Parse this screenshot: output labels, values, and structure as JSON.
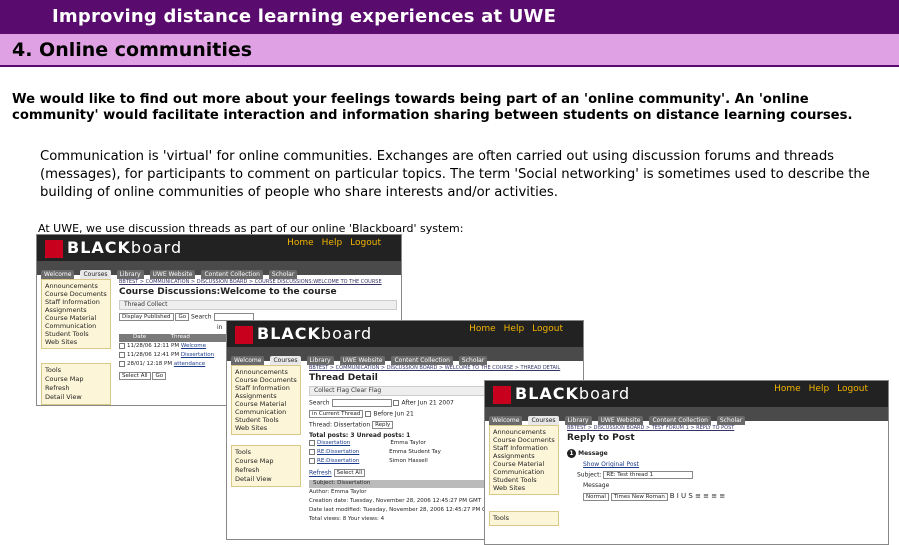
{
  "banner": {
    "title": "Improving distance learning experiences at UWE"
  },
  "section": {
    "title": "4. Online communities"
  },
  "intro": "We would like to find out more about your feelings towards being part of an 'online community'. An 'online community' would facilitate interaction and information sharing between students on distance learning courses.",
  "body": "Communication is 'virtual' for online communities. Exchanges are often carried out using discussion forums and threads (messages), for participants to comment on particular topics. The term 'Social networking' is sometimes used to describe the building of online communities of people who share interests and/or activities.",
  "lead": "At UWE, we use discussion threads as part of our online 'Blackboard' system:",
  "bb": {
    "logo_bold": "BLACK",
    "logo_thin": "board",
    "header_links": [
      "Home",
      "Help",
      "Logout"
    ],
    "tabs": [
      "Welcome",
      "Courses",
      "Library",
      "UWE Website",
      "Content Collection",
      "Scholar"
    ],
    "menu": [
      "Announcements",
      "Course Documents",
      "Staff Information",
      "Assignments",
      "Course Material",
      "Communication",
      "Student Tools",
      "Web Sites"
    ],
    "tools": [
      "Tools",
      "Course Map",
      "Refresh",
      "Detail View"
    ],
    "s1": {
      "crumb": "BBTEST > COMMUNICATION > DISCUSSION BOARD > COURSE DISCUSSIONS:WELCOME TO THE COURSE",
      "title": "Course Discussions:Welcome to the course",
      "bar": "Thread  Collect",
      "display": "Display Published",
      "go": "Go",
      "search": "Search",
      "in": "in",
      "cols": [
        "Date",
        "Thread"
      ],
      "rows": [
        {
          "date": "11/28/06 12:11 PM",
          "thread": "Welcome"
        },
        {
          "date": "11/28/06 12:41 PM",
          "thread": "Dissertation"
        },
        {
          "date": "28/01/ 12:18 PM",
          "thread": "attendance"
        }
      ],
      "select": "Select All"
    },
    "s2": {
      "crumb": "BBTEST > COMMUNICATION > DISCUSSION BOARD > WELCOME TO THE COURSE > THREAD DETAIL",
      "title": "Thread Detail",
      "bar": "Collect  Flag  Clear Flag",
      "search": "Search",
      "in": "in Current Thread",
      "after": "After Jun 21 2007",
      "before": "Before Jun 21",
      "thread_label": "Thread: Dissertation",
      "reply": "Reply",
      "totals": "Total posts: 3    Unread posts: 1",
      "posts": [
        {
          "title": "Dissertation",
          "author": "Emma Taylor"
        },
        {
          "title": "RE:Dissertation",
          "author": "Emma Student Tay"
        },
        {
          "title": "RE:Dissertation",
          "author": "Simon Hassell"
        }
      ],
      "refresh": "Refresh",
      "select": "Select All",
      "subject": "Subject: Dissertation",
      "meta": [
        "Author: Emma Taylor",
        "Creation date: Tuesday, November 28, 2006 12:45:27 PM GMT",
        "Date last modified: Tuesday, November 28, 2006 12:45:27 PM GMT",
        "Total views: 8   Your views: 4"
      ]
    },
    "s3": {
      "crumb": "BBTEST > DISCUSSION BOARD > TEST FORUM 1 > REPLY TO POST",
      "title": "Reply to Post",
      "step": "1",
      "message": "Message",
      "show": "Show Original Post",
      "subject_label": "Subject:",
      "subject_value": "RE: Test thread 1",
      "message_label": "Message",
      "fmt": "Normal",
      "font": "Times New Roman",
      "tools": "Tools"
    }
  },
  "colors": {
    "banner": "#5a0b6e",
    "section": "#e0a0e4"
  }
}
